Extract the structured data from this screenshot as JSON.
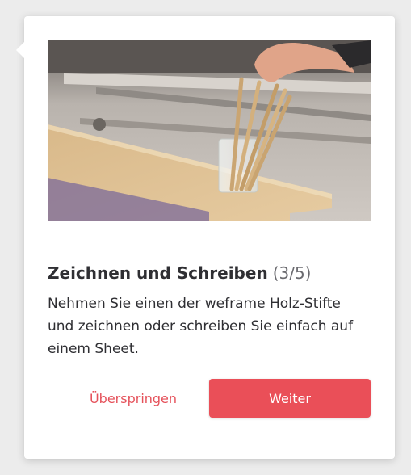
{
  "onboarding": {
    "title": "Zeichnen und Schreiben",
    "step": "(3/5)",
    "description": "Nehmen Sie einen der weframe Holz-Stifte und zeichnen oder schreiben Sie einfach auf einem Sheet.",
    "skip_label": "Überspringen",
    "next_label": "Weiter"
  },
  "colors": {
    "accent": "#ea4f58",
    "text": "#2f2f33"
  }
}
